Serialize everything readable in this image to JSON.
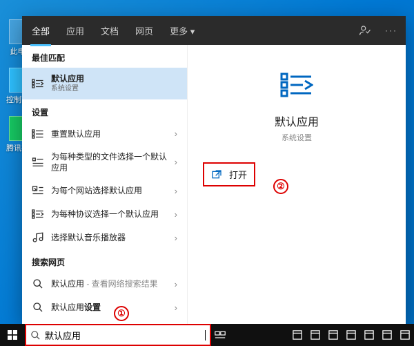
{
  "desktop": {
    "icons": [
      {
        "label": "此电脑"
      },
      {
        "label": "控制面板"
      },
      {
        "label": "腾讯视频"
      }
    ]
  },
  "flyout": {
    "tabs": {
      "all": "全部",
      "apps": "应用",
      "docs": "文档",
      "web": "网页",
      "more": "更多"
    },
    "best_match_h": "最佳匹配",
    "best_match": {
      "title": "默认应用",
      "subtitle": "系统设置"
    },
    "settings_h": "设置",
    "settings": [
      {
        "label": "重置默认应用"
      },
      {
        "label": "为每种类型的文件选择一个默认应用"
      },
      {
        "label": "为每个网站选择默认应用"
      },
      {
        "label": "为每种协议选择一个默认应用"
      },
      {
        "label": "选择默认音乐播放器"
      }
    ],
    "web_h": "搜索网页",
    "web": [
      {
        "label": "默认应用",
        "suffix": " - 查看网络搜索结果"
      },
      {
        "label_pre": "默认应用",
        "label_bold": "设置"
      }
    ],
    "preview": {
      "title": "默认应用",
      "subtitle": "系统设置",
      "open": "打开"
    }
  },
  "search": {
    "value": "默认应用"
  },
  "annotations": {
    "one": "①",
    "two": "②"
  }
}
